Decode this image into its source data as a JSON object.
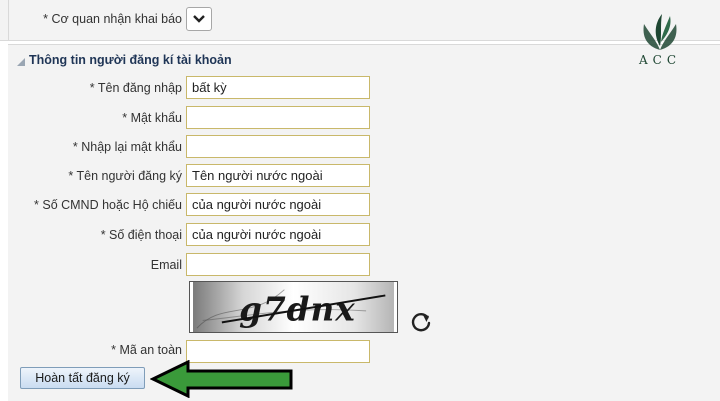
{
  "top": {
    "agency_label": "* Cơ quan nhận khai báo",
    "agency_selected": ""
  },
  "section": {
    "title": "Thông tin người đăng kí tài khoản"
  },
  "form": {
    "username": {
      "label": "* Tên đăng nhập",
      "value": "bất kỳ"
    },
    "password": {
      "label": "* Mật khẩu",
      "value": ""
    },
    "password_confirm": {
      "label": "* Nhập lại mật khẩu",
      "value": ""
    },
    "registrant_name": {
      "label": "* Tên người đăng ký",
      "value": "Tên người nước ngoài"
    },
    "id_number": {
      "label": "* Số CMND hoặc Hộ chiếu",
      "value": "của người nước ngoài"
    },
    "phone": {
      "label": "* Số điện thoại",
      "value": "của người nước ngoài"
    },
    "email": {
      "label": "Email",
      "value": ""
    },
    "captcha_text": "g7dnx",
    "security_code": {
      "label": "* Mã an toàn",
      "value": ""
    }
  },
  "submit_label": "Hoàn tất đăng ký",
  "watermark": {
    "text": "ACC",
    "color": "#1e4632"
  },
  "colors": {
    "arrow_fill": "#3a9a3a",
    "section_title": "#1f3556",
    "field_border": "#c9b86a"
  }
}
